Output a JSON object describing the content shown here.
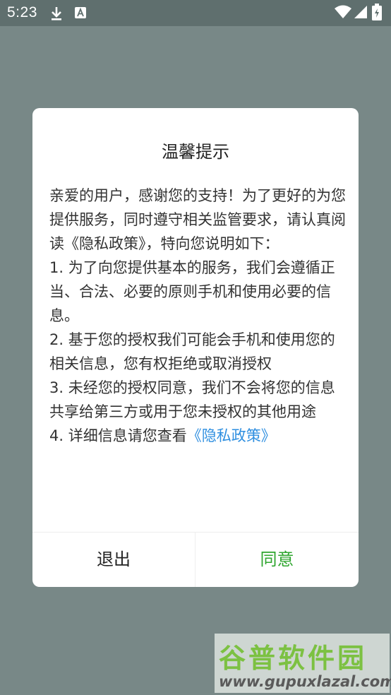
{
  "status_bar": {
    "time": "5:23",
    "icons": [
      "download-icon",
      "keyboard-a-icon",
      "wifi-icon",
      "signal-icon",
      "battery-icon"
    ]
  },
  "dialog": {
    "title": "温馨提示",
    "lines": [
      "亲爱的用户，感谢您的支持！为了更好的为您提供服务，同时遵守相关监管要求，请认真阅读《隐私政策》，特向您说明如下：",
      "1. 为了向您提供基本的服务，我们会遵循正当、合法、必要的原则手机和使用必要的信息。",
      "2. 基于您的授权我们可能会手机和使用您的相关信息，您有权拒绝或取消授权",
      "3. 未经您的授权同意，我们不会将您的信息共享给第三方或用于您未授权的其他用途"
    ],
    "last_line_prefix": "4. 详细信息请您查看",
    "privacy_link": "《隐私政策》",
    "exit_label": "退出",
    "agree_label": "同意"
  },
  "watermark": {
    "title": "谷普软件园",
    "url": "www.gupuxlazal.com"
  },
  "colors": {
    "overlay": "#788887",
    "status_bar": "#5f6f6e",
    "link": "#2f8fe0",
    "agree": "#2ea52e"
  }
}
